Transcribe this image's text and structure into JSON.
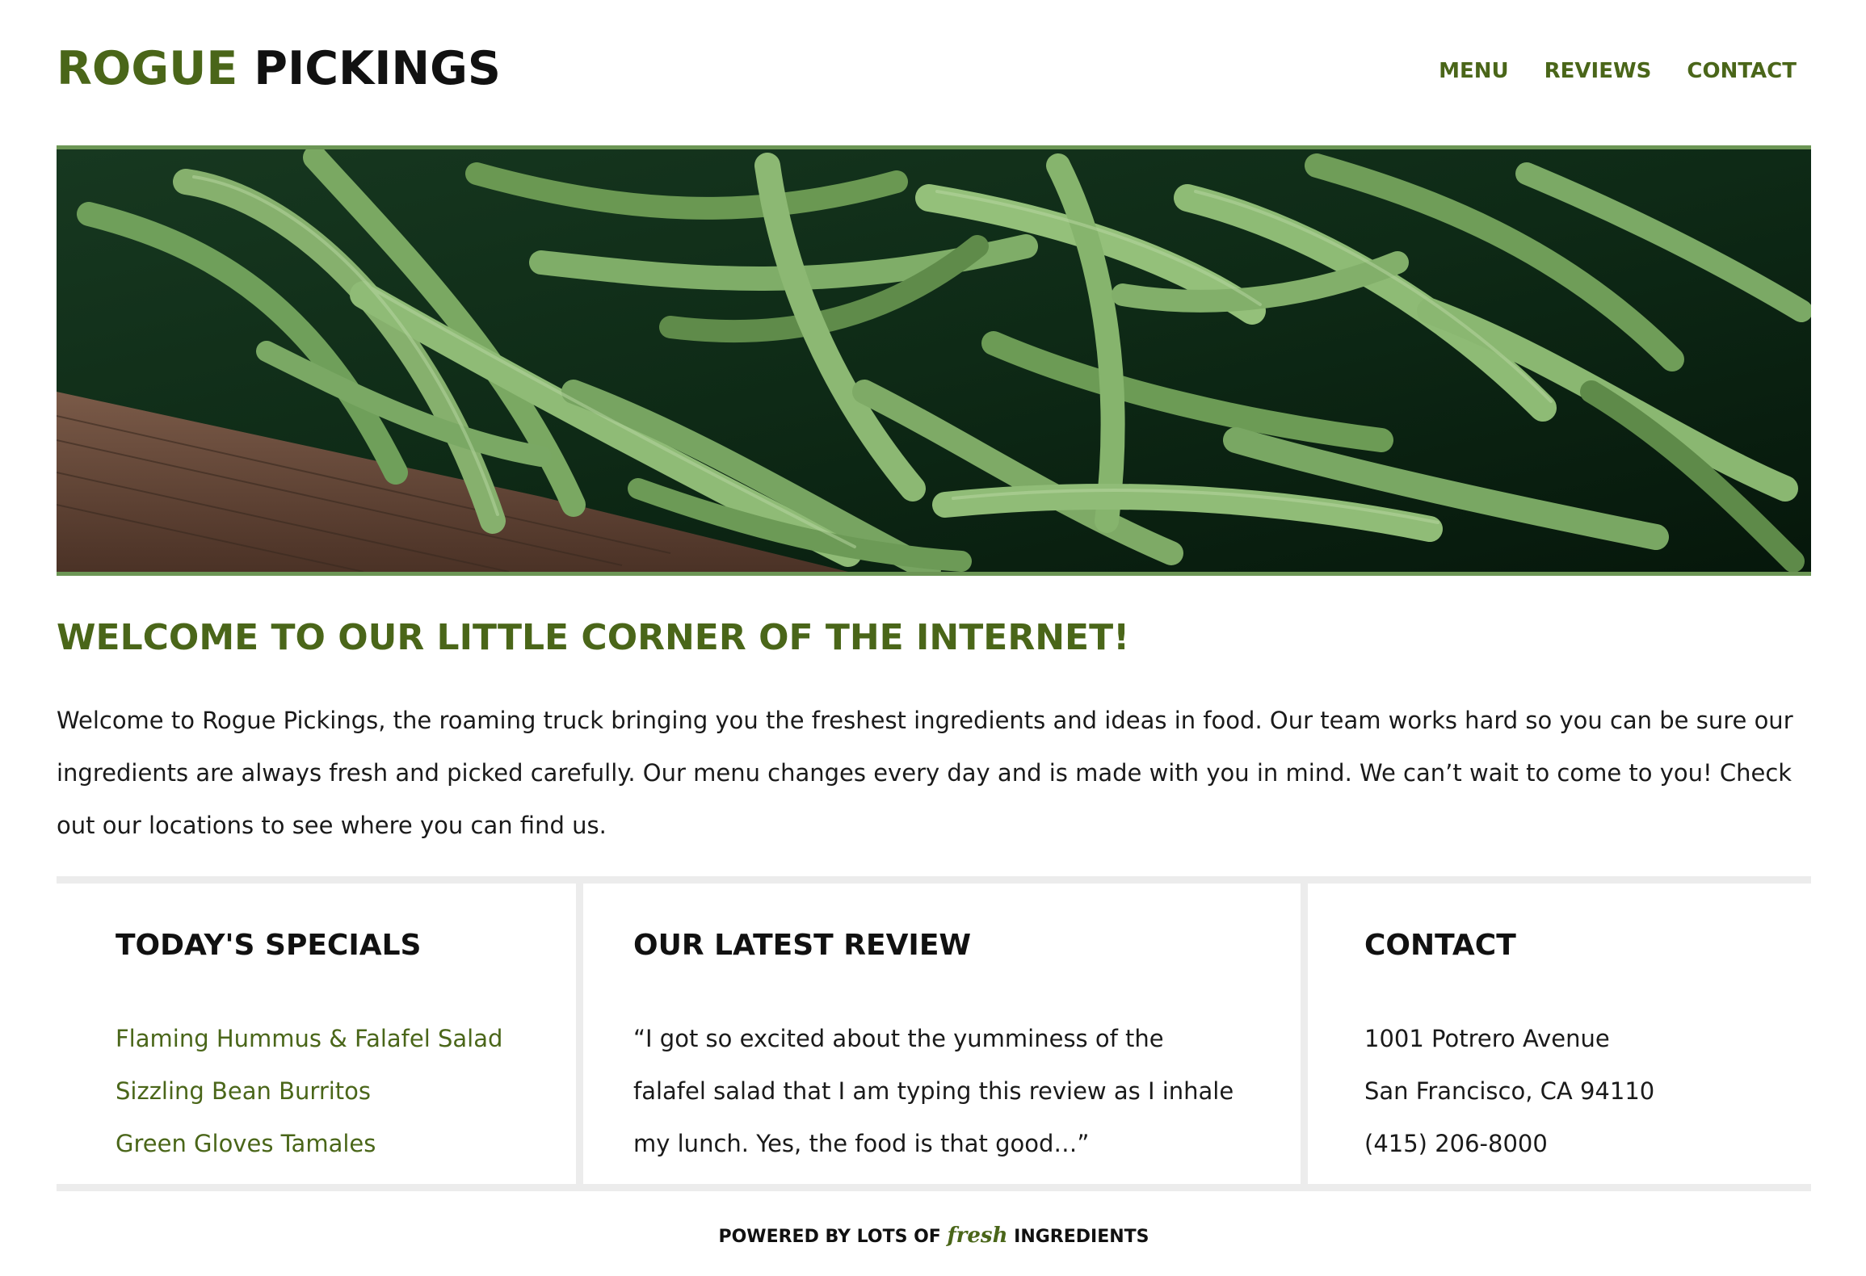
{
  "brand": {
    "part1": "ROGUE",
    "part2": "PICKINGS",
    "accent_color": "#4a6619"
  },
  "nav": {
    "items": [
      "MENU",
      "REVIEWS",
      "CONTACT"
    ]
  },
  "hero": {
    "image": "green-beans-photo",
    "border_color": "#6c9655"
  },
  "welcome": {
    "title": "WELCOME TO OUR LITTLE CORNER OF THE INTERNET!",
    "body": "Welcome to Rogue Pickings, the roaming truck bringing you the freshest ingredients and ideas in food. Our team works hard so you can be sure our ingredients are always fresh and picked carefully. Our menu changes every day and is made with you in mind. We can’t wait to come to you! Check out our locations to see where you can find us."
  },
  "specials": {
    "title": "TODAY'S SPECIALS",
    "items": [
      "Flaming Hummus & Falafel Salad",
      "Sizzling Bean Burritos",
      "Green Gloves Tamales"
    ]
  },
  "review": {
    "title": "OUR LATEST REVIEW",
    "lines": [
      "“I got so excited about the yumminess of the",
      "falafel salad that I am typing this review as I inhale",
      "my lunch. Yes, the food is that good…”"
    ]
  },
  "contact": {
    "title": "CONTACT",
    "lines": [
      "1001 Potrero Avenue",
      "San Francisco, CA 94110",
      "(415) 206-8000"
    ]
  },
  "footer": {
    "before": "POWERED BY LOTS OF",
    "highlight": "fresh",
    "after": "INGREDIENTS"
  }
}
